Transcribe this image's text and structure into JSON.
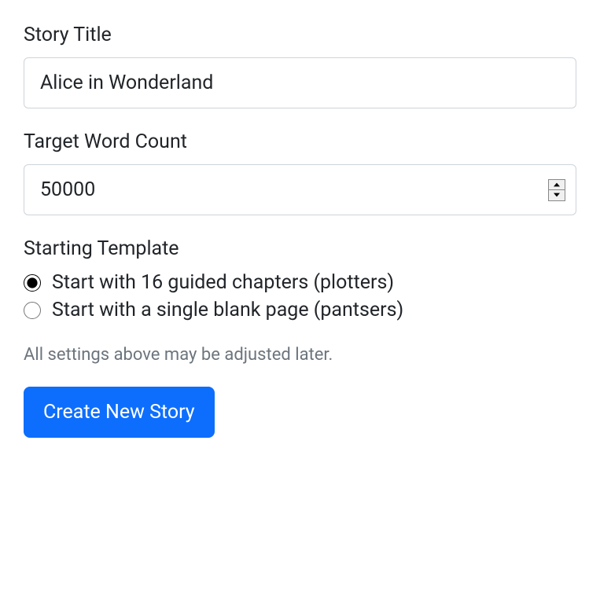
{
  "form": {
    "title": {
      "label": "Story Title",
      "value": "Alice in Wonderland"
    },
    "wordCount": {
      "label": "Target Word Count",
      "value": "50000"
    },
    "template": {
      "label": "Starting Template",
      "options": [
        {
          "label": "Start with 16 guided chapters (plotters)",
          "checked": true
        },
        {
          "label": "Start with a single blank page (pantsers)",
          "checked": false
        }
      ]
    },
    "helpText": "All settings above may be adjusted later.",
    "submitLabel": "Create New Story"
  }
}
